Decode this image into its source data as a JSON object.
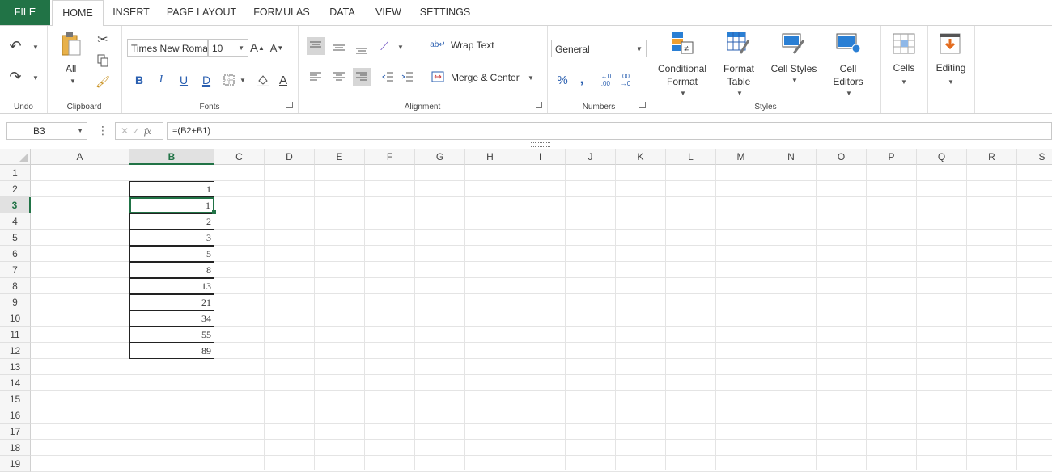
{
  "tabs": {
    "file": "FILE",
    "items": [
      "HOME",
      "INSERT",
      "PAGE LAYOUT",
      "FORMULAS",
      "DATA",
      "VIEW",
      "SETTINGS"
    ]
  },
  "ribbon": {
    "undo_group": "Undo",
    "clipboard": {
      "label": "Clipboard",
      "paste_all": "All"
    },
    "fonts": {
      "label": "Fonts",
      "font_name": "Times New Roman",
      "font_size": "10"
    },
    "alignment": {
      "label": "Alignment",
      "wrap_text": "Wrap Text",
      "merge_center": "Merge & Center"
    },
    "numbers": {
      "label": "Numbers",
      "format": "General"
    },
    "styles": {
      "label": "Styles",
      "conditional": [
        "Conditional",
        "Format"
      ],
      "format_table": [
        "Format",
        "Table"
      ],
      "cell_styles": "Cell Styles",
      "cell_editors": [
        "Cell",
        "Editors"
      ]
    },
    "cells": "Cells",
    "editing": "Editing"
  },
  "formula_bar": {
    "name_box": "B3",
    "fx": "fx",
    "formula": "=(B2+B1)"
  },
  "sheet": {
    "columns": [
      "A",
      "B",
      "C",
      "D",
      "E",
      "F",
      "G",
      "H",
      "I",
      "J",
      "K",
      "L",
      "M",
      "N",
      "O",
      "P",
      "Q",
      "R",
      "S"
    ],
    "rows": [
      "1",
      "2",
      "3",
      "4",
      "5",
      "6",
      "7",
      "8",
      "9",
      "10",
      "11",
      "12",
      "13",
      "14",
      "15",
      "16",
      "17",
      "18",
      "19"
    ],
    "selected_column": "B",
    "selected_row": "3",
    "column_b_values": [
      "",
      "1",
      "1",
      "2",
      "3",
      "5",
      "8",
      "13",
      "21",
      "34",
      "55",
      "89"
    ]
  },
  "colors": {
    "accent": "#217346",
    "file_tab": "#217346"
  }
}
